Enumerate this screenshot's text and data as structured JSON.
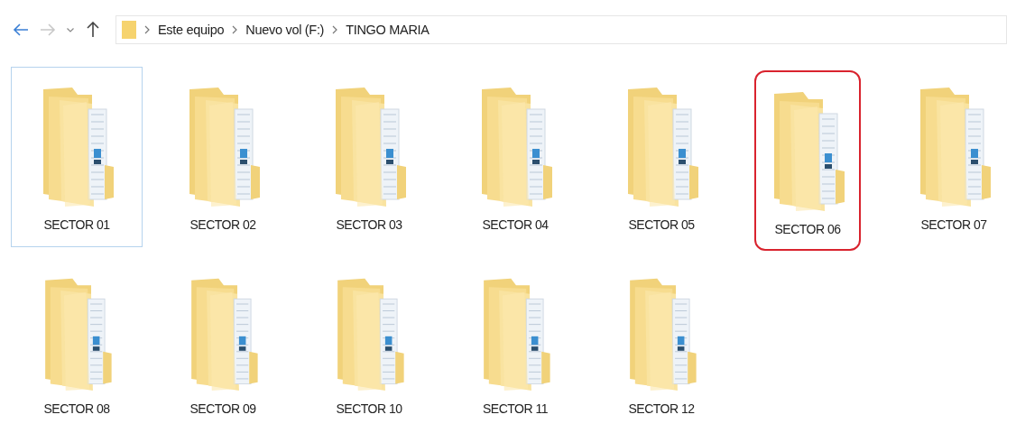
{
  "address_bar": {
    "breadcrumbs": [
      "Este equipo",
      "Nuevo vol (F:)",
      "TINGO MARIA"
    ]
  },
  "nav": {
    "back_enabled": true,
    "forward_enabled": false
  },
  "folders": [
    {
      "name": "SECTOR 01",
      "focused": true,
      "circled": false
    },
    {
      "name": "SECTOR 02",
      "focused": false,
      "circled": false
    },
    {
      "name": "SECTOR 03",
      "focused": false,
      "circled": false
    },
    {
      "name": "SECTOR 04",
      "focused": false,
      "circled": false
    },
    {
      "name": "SECTOR 05",
      "focused": false,
      "circled": false
    },
    {
      "name": "SECTOR 06",
      "focused": false,
      "circled": true
    },
    {
      "name": "SECTOR 07",
      "focused": false,
      "circled": false
    },
    {
      "name": "SECTOR 08",
      "focused": false,
      "circled": false
    },
    {
      "name": "SECTOR 09",
      "focused": false,
      "circled": false
    },
    {
      "name": "SECTOR 10",
      "focused": false,
      "circled": false
    },
    {
      "name": "SECTOR 11",
      "focused": false,
      "circled": false
    },
    {
      "name": "SECTOR 12",
      "focused": false,
      "circled": false
    }
  ]
}
